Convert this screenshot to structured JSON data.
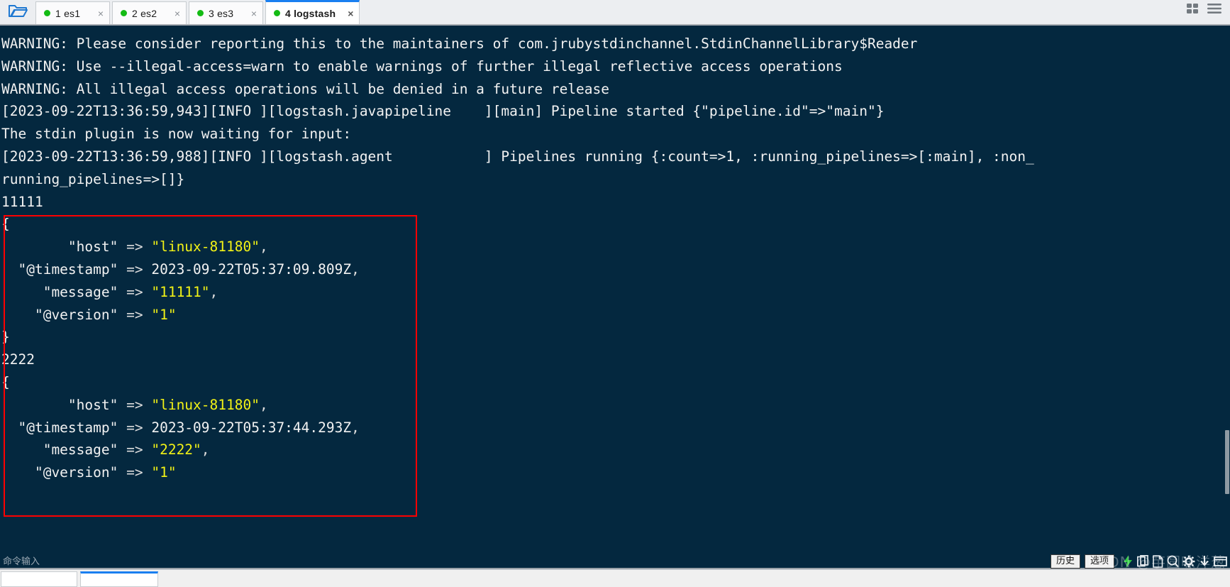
{
  "window": {
    "folder_icon": "folder-open-icon",
    "grid_icon": "grid-view-icon",
    "menu_icon": "hamburger-menu-icon"
  },
  "tabs": [
    {
      "label": "1 es1",
      "status": "connected",
      "close": "×",
      "active": false
    },
    {
      "label": "2 es2",
      "status": "connected",
      "close": "×",
      "active": false
    },
    {
      "label": "3 es3",
      "status": "connected",
      "close": "×",
      "active": false
    },
    {
      "label": "4 logstash",
      "status": "connected",
      "close": "×",
      "active": true
    }
  ],
  "terminal": {
    "lines": [
      {
        "text": "WARNING: Please consider reporting this to the maintainers of com.jrubystdinchannel.StdinChannelLibrary$Reader"
      },
      {
        "text": "WARNING: Use --illegal-access=warn to enable warnings of further illegal reflective access operations"
      },
      {
        "text": "WARNING: All illegal access operations will be denied in a future release"
      },
      {
        "text": "[2023-09-22T13:36:59,943][INFO ][logstash.javapipeline    ][main] Pipeline started {\"pipeline.id\"=>\"main\"}"
      },
      {
        "text": "The stdin plugin is now waiting for input:"
      },
      {
        "text": "[2023-09-22T13:36:59,988][INFO ][logstash.agent           ] Pipelines running {:count=>1, :running_pipelines=>[:main], :non_"
      },
      {
        "text": "running_pipelines=>[]}"
      }
    ],
    "events": [
      {
        "echo": "11111",
        "open": "{",
        "fields": [
          {
            "key": "\"host\"",
            "arrow": " => ",
            "value": "\"linux-81180\"",
            "comma": ",",
            "highlight": true,
            "indent": "        "
          },
          {
            "key": "\"@timestamp\"",
            "arrow": " => ",
            "value": "2023-09-22T05:37:09.809Z",
            "comma": ",",
            "highlight": false,
            "indent": "  "
          },
          {
            "key": "\"message\"",
            "arrow": " => ",
            "value": "\"11111\"",
            "comma": ",",
            "highlight": true,
            "indent": "     "
          },
          {
            "key": "\"@version\"",
            "arrow": " => ",
            "value": "\"1\"",
            "comma": "",
            "highlight": true,
            "indent": "    "
          }
        ],
        "close": "}"
      },
      {
        "echo": "2222",
        "open": "{",
        "fields": [
          {
            "key": "\"host\"",
            "arrow": " => ",
            "value": "\"linux-81180\"",
            "comma": ",",
            "highlight": true,
            "indent": "        "
          },
          {
            "key": "\"@timestamp\"",
            "arrow": " => ",
            "value": "2023-09-22T05:37:44.293Z",
            "comma": ",",
            "highlight": false,
            "indent": "  "
          },
          {
            "key": "\"message\"",
            "arrow": " => ",
            "value": "\"2222\"",
            "comma": ",",
            "highlight": true,
            "indent": "     "
          },
          {
            "key": "\"@version\"",
            "arrow": " => ",
            "value": "\"1\"",
            "comma": "",
            "highlight": true,
            "indent": "    "
          }
        ],
        "close": ""
      }
    ],
    "colors": {
      "background": "#04283f",
      "foreground": "#f2f2f2",
      "string_value": "#f2f216",
      "annotation_box": "#ff0000"
    }
  },
  "command_bar": {
    "placeholder": "命令输入",
    "value": "",
    "history_button": "历史",
    "options_button": "选项",
    "tray_icons": [
      "lightning-bolt-icon",
      "clipboard-copy-icon",
      "document-icon",
      "search-icon",
      "gear-icon",
      "download-icon",
      "window-icon"
    ]
  },
  "watermark": {
    "text": "CSDN @芋圆味洋葱"
  },
  "bottom_bar": {
    "dots": "· · · ·"
  }
}
